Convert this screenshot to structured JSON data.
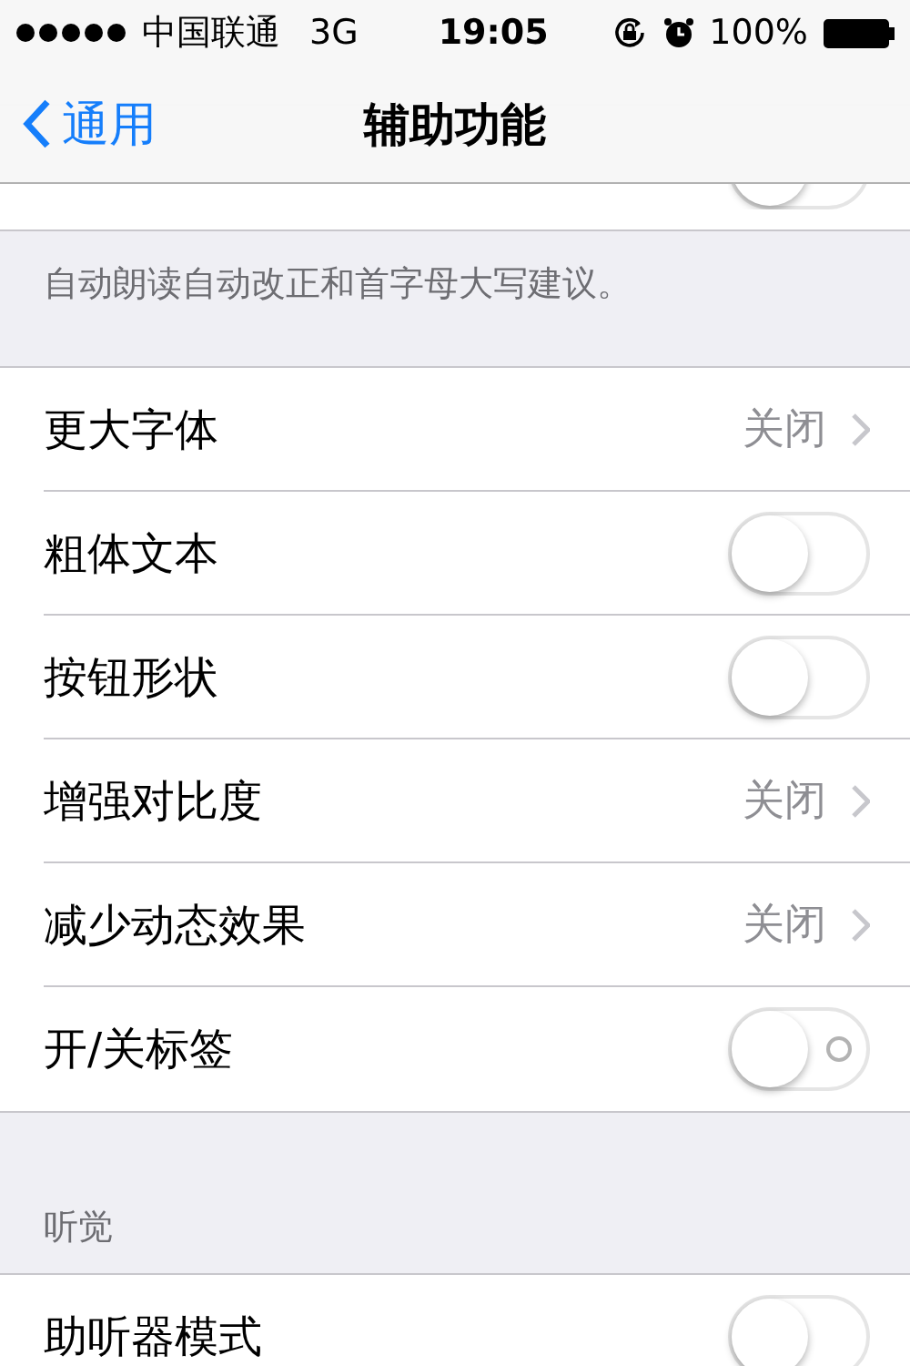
{
  "status_bar": {
    "carrier": "中国联通",
    "network": "3G",
    "time": "19:05",
    "battery": "100%"
  },
  "nav": {
    "back": "通用",
    "title": "辅助功能"
  },
  "top_row": {
    "kind": "switch",
    "on": false
  },
  "top_note": "自动朗读自动改正和首字母大写建议。",
  "rows": [
    {
      "kind": "detail",
      "label": "更大字体",
      "value": "关闭"
    },
    {
      "kind": "switch",
      "label": "粗体文本",
      "on": false
    },
    {
      "kind": "switch",
      "label": "按钮形状",
      "on": false
    },
    {
      "kind": "detail",
      "label": "增强对比度",
      "value": "关闭"
    },
    {
      "kind": "detail",
      "label": "减少动态效果",
      "value": "关闭"
    },
    {
      "kind": "switch",
      "label": "开/关标签",
      "on": false,
      "label_mark": true
    }
  ],
  "hearing": {
    "header": "听觉",
    "rows": [
      {
        "kind": "switch",
        "label": "助听器模式",
        "on": false
      }
    ]
  }
}
